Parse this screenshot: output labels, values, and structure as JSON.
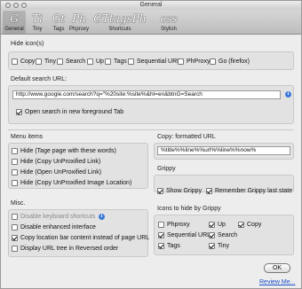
{
  "window": {
    "title": "General"
  },
  "toolbar": {
    "items": [
      {
        "label": "General",
        "icon": "general-icon"
      },
      {
        "label": "Tiny",
        "icon": "tiny-icon"
      },
      {
        "label": "Tags",
        "icon": "tags-icon"
      },
      {
        "label": "Phproxy",
        "icon": "phproxy-icon"
      },
      {
        "label": "Shortcuts",
        "icon": "shortcuts-icon"
      },
      {
        "label": "Stylish",
        "icon": "stylish-icon"
      }
    ]
  },
  "hide_icons": {
    "title": "Hide icon(s)",
    "options": [
      {
        "label": "Copy",
        "checked": false
      },
      {
        "label": "Tiny",
        "checked": false
      },
      {
        "label": "Search",
        "checked": false
      },
      {
        "label": "Up",
        "checked": false
      },
      {
        "label": "Tags",
        "checked": false
      },
      {
        "label": "Sequential URL",
        "checked": false
      },
      {
        "label": "PhProxy",
        "checked": false
      },
      {
        "label": "Go (firefox)",
        "checked": false
      }
    ]
  },
  "search": {
    "title": "Default search URL:",
    "value": "http://www.google.com/search?q=\"%20site:%site%&hl=en&btnG=Search",
    "new_tab_label": "Open search in new foreground Tab",
    "new_tab_checked": true
  },
  "menu_items": {
    "title": "Menu items",
    "options": [
      {
        "label": "Hide (Tage page with these words)",
        "checked": false
      },
      {
        "label": "Hide (Copy UnProxified Link)",
        "checked": false
      },
      {
        "label": "Hide (Open UnProxified Link)",
        "checked": false
      },
      {
        "label": "Hide (Copy UnProxified Image Location)",
        "checked": false
      }
    ]
  },
  "copy_formatted": {
    "title": "Copy: formatted URL",
    "value": "%title%%line%%url%%line%%now%"
  },
  "grippy": {
    "title": "Grippy",
    "show_label": "Show Grippy",
    "show_checked": true,
    "remember_label": "Remember Grippy last state",
    "remember_checked": true,
    "icons_title": "Icons to hide by Grippy",
    "icons": [
      {
        "label": "Phproxy",
        "checked": false
      },
      {
        "label": "Up",
        "checked": true
      },
      {
        "label": "Copy",
        "checked": true
      },
      {
        "label": "Sequential URL",
        "checked": true
      },
      {
        "label": "Search",
        "checked": true
      },
      {
        "label": "Tags",
        "checked": true
      },
      {
        "label": "Tiny",
        "checked": true
      }
    ]
  },
  "misc": {
    "title": "Misc.",
    "options": [
      {
        "label": "Disable keyboard shortcuts",
        "checked": false,
        "disabled": true
      },
      {
        "label": "Disable enhanced interface",
        "checked": false
      },
      {
        "label": "Copy location bar content instead of page URL",
        "checked": true
      },
      {
        "label": "Display URL tree in Reversed order",
        "checked": false
      }
    ]
  },
  "footer": {
    "ok_label": "OK",
    "review_label": "Review Me..."
  }
}
